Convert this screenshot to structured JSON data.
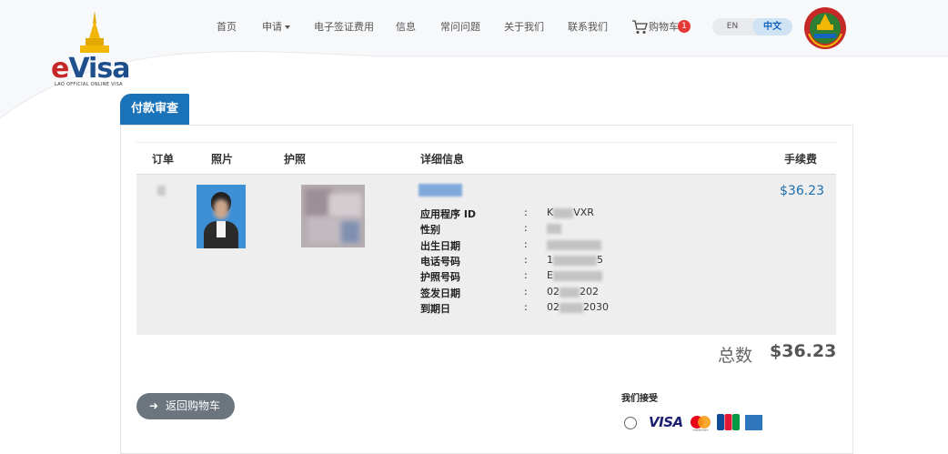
{
  "logo": {
    "brand_e": "e",
    "brand_visa": "Visa",
    "subtitle": "LAO OFFICIAL ONLINE VISA"
  },
  "nav": {
    "home": "首页",
    "apply": "申请",
    "fees": "电子签证费用",
    "info": "信息",
    "faq": "常问问题",
    "about": "关于我们",
    "contact": "联系我们",
    "cart": "购物车",
    "cart_count": "1"
  },
  "lang": {
    "en": "EN",
    "zh": "中文",
    "active": "中文"
  },
  "review": {
    "tab_title": "付款审查",
    "columns": {
      "order": "订单",
      "photo": "照片",
      "passport": "护照",
      "details": "详细信息",
      "fee": "手续费"
    },
    "item": {
      "fields": [
        {
          "label": "应用程序 ID",
          "value_prefix": "K",
          "value_suffix": "VXR"
        },
        {
          "label": "性别",
          "value_prefix": "",
          "value_suffix": ""
        },
        {
          "label": "出生日期",
          "value_prefix": "",
          "value_suffix": ""
        },
        {
          "label": "电话号码",
          "value_prefix": "1",
          "value_suffix": "5"
        },
        {
          "label": "护照号码",
          "value_prefix": "E",
          "value_suffix": ""
        },
        {
          "label": "签发日期",
          "value_prefix": "02",
          "value_suffix": "202"
        },
        {
          "label": "到期日",
          "value_prefix": "02",
          "value_suffix": "2030"
        }
      ],
      "colon": ":",
      "fee": "$36.23"
    },
    "total_label": "总数",
    "total_value": "$36.23"
  },
  "footer": {
    "back_label": "返回购物车",
    "accept_label": "我们接受",
    "payment_methods": [
      "VISA",
      "Mastercard",
      "JCB",
      "American Express"
    ],
    "visa_text": "VISA",
    "mastercard_text": "mastercard"
  },
  "colors": {
    "primary": "#1a73b8",
    "fee_blue": "#1a6fb0",
    "badge_red": "#e53935",
    "button_gray": "#6c757d"
  }
}
